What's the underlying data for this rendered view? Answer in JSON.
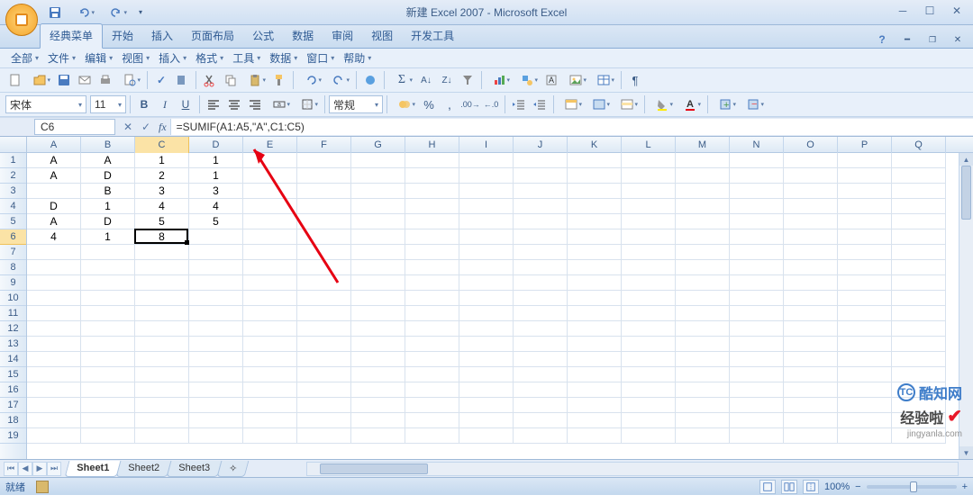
{
  "title": "新建 Excel 2007 - Microsoft Excel",
  "ribbon_tabs": [
    "经典菜单",
    "开始",
    "插入",
    "页面布局",
    "公式",
    "数据",
    "审阅",
    "视图",
    "开发工具"
  ],
  "active_ribbon_tab": 0,
  "menubar": [
    "全部",
    "文件",
    "编辑",
    "视图",
    "插入",
    "格式",
    "工具",
    "数据",
    "窗口",
    "帮助"
  ],
  "font": {
    "name": "宋体",
    "size": "11"
  },
  "number_format": "常规",
  "namebox": "C6",
  "formula": "=SUMIF(A1:A5,\"A\",C1:C5)",
  "columns": [
    "A",
    "B",
    "C",
    "D",
    "E",
    "F",
    "G",
    "H",
    "I",
    "J",
    "K",
    "L",
    "M",
    "N",
    "O",
    "P",
    "Q"
  ],
  "row_count": 19,
  "selected_cell": {
    "row": 6,
    "col": 3
  },
  "cells": {
    "A1": "A",
    "B1": "A",
    "C1": "1",
    "D1": "1",
    "A2": "A",
    "B2": "D",
    "C2": "2",
    "D2": "1",
    "B3": "B",
    "C3": "3",
    "D3": "3",
    "A4": "D",
    "B4": "1",
    "C4": "4",
    "D4": "4",
    "A5": "A",
    "B5": "D",
    "C5": "5",
    "D5": "5",
    "A6": "4",
    "B6": "1",
    "C6": "8"
  },
  "sheets": [
    "Sheet1",
    "Sheet2",
    "Sheet3"
  ],
  "active_sheet": 0,
  "status": "就绪",
  "zoom": "100%",
  "watermark": {
    "line1": "酷知网",
    "line2": "经验啦",
    "url": "jingyanla.com"
  }
}
